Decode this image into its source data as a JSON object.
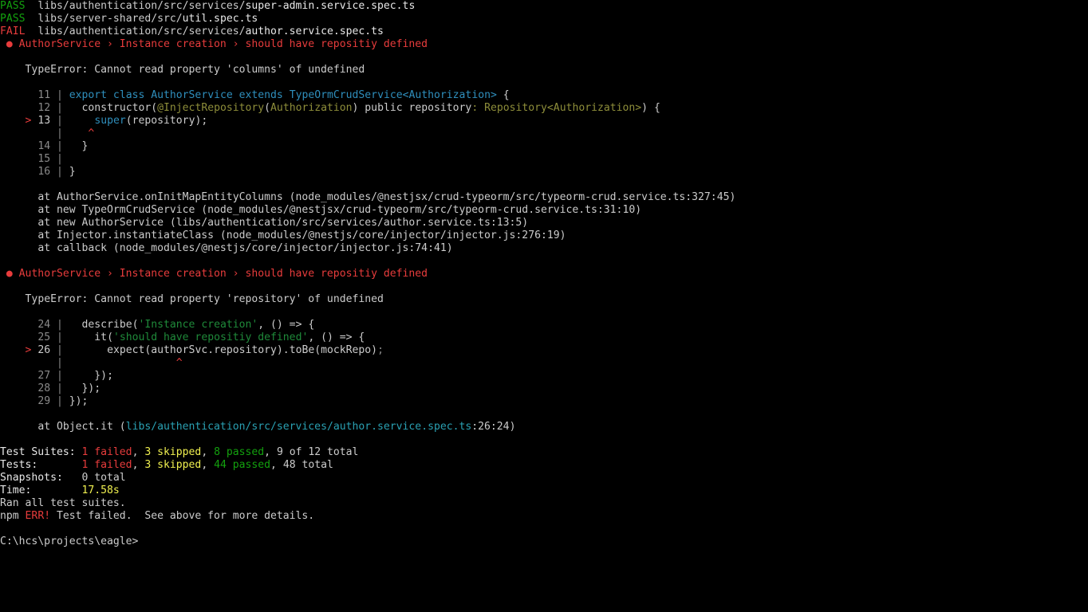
{
  "terminal": {
    "results": [
      {
        "status": "PASS",
        "dir": "libs/authentication/src/services/",
        "file": "super-admin.service.spec.ts"
      },
      {
        "status": "PASS",
        "dir": "libs/server-shared/src/",
        "file": "util.spec.ts"
      },
      {
        "status": "FAIL",
        "dir": "libs/authentication/src/services/",
        "file": "author.service.spec.ts"
      }
    ],
    "failures": [
      {
        "title": "● AuthorService › Instance creation › should have repositiy defined",
        "error": "TypeError: Cannot read property 'columns' of undefined",
        "code": {
          "l11_no": "11",
          "l11_kw": "export class",
          "l11_name": "AuthorService",
          "l11_ext": "extends",
          "l11_type": "TypeOrmCrudService<Authorization>",
          "l11_end": " {",
          "l12_no": "12",
          "l12_a": "constructor(",
          "l12_dec": "@InjectRepository",
          "l12_b": "(",
          "l12_dec2": "Authorization",
          "l12_c": ") public repository",
          "l12_d": ": ",
          "l12_type": "Repository<Authorization>",
          "l12_e": ") {",
          "l13_marker": ">",
          "l13_no": "13",
          "l13_fn": "super",
          "l13_rest": "(repository);",
          "caret": "^",
          "l14_no": "14",
          "l14_text": "}",
          "l15_no": "15",
          "l15_text": "",
          "l16_no": "16",
          "l16_text": "}"
        },
        "stack": [
          "at AuthorService.onInitMapEntityColumns (node_modules/@nestjsx/crud-typeorm/src/typeorm-crud.service.ts:327:45)",
          "at new TypeOrmCrudService (node_modules/@nestjsx/crud-typeorm/src/typeorm-crud.service.ts:31:10)",
          "at new AuthorService (libs/authentication/src/services/author.service.ts:13:5)",
          "at Injector.instantiateClass (node_modules/@nestjs/core/injector/injector.js:276:19)",
          "at callback (node_modules/@nestjs/core/injector/injector.js:74:41)"
        ]
      },
      {
        "title": "● AuthorService › Instance creation › should have repositiy defined",
        "error": "TypeError: Cannot read property 'repository' of undefined",
        "code": {
          "l24_no": "24",
          "l24_a": "describe(",
          "l24_str": "'Instance creation'",
          "l24_b": ", () => {",
          "l25_no": "25",
          "l25_a": "it(",
          "l25_str": "'should have repositiy defined'",
          "l25_b": ", () => {",
          "l26_marker": ">",
          "l26_no": "26",
          "l26_a": "expect(authorSvc.repository).toBe(mockRepo)",
          "l26_b": ";",
          "caret": "^",
          "l27_no": "27",
          "l27_text": "});",
          "l28_no": "28",
          "l28_text": "});",
          "l29_no": "29",
          "l29_text": "});"
        },
        "stack_prefix": "at Object.it (",
        "stack_path": "libs/authentication/src/services/author.service.spec.ts",
        "stack_suffix": ":26:24)"
      }
    ],
    "summary": {
      "suites_label": "Test Suites:",
      "suites_failed": "1 failed",
      "suites_skipped": "3 skipped",
      "suites_passed": "8 passed",
      "suites_total": "9 of 12 total",
      "tests_label": "Tests:",
      "tests_failed": "1 failed",
      "tests_skipped": "3 skipped",
      "tests_passed": "44 passed",
      "tests_total": "48 total",
      "snap_label": "Snapshots:",
      "snap_value": "0 total",
      "time_label": "Time:",
      "time_value": "17.58s",
      "ran": "Ran all test suites.",
      "npm": "npm",
      "err": "ERR!",
      "npm_msg": " Test failed.  See above for more details."
    },
    "prompt": "C:\\hcs\\projects\\eagle>"
  }
}
